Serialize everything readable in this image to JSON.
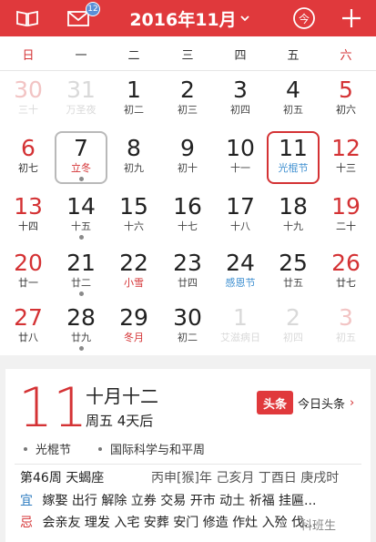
{
  "header": {
    "title": "2016年11月",
    "mail_badge": "12",
    "today_label": "今",
    "add_label": "+"
  },
  "weekdays": [
    "日",
    "一",
    "二",
    "三",
    "四",
    "五",
    "六"
  ],
  "calendar": {
    "rows": [
      [
        {
          "day": "30",
          "sub": "三十",
          "other": true
        },
        {
          "day": "31",
          "sub": "万圣夜",
          "other": true,
          "festival": "blue"
        },
        {
          "day": "1",
          "sub": "初二"
        },
        {
          "day": "2",
          "sub": "初三"
        },
        {
          "day": "3",
          "sub": "初四"
        },
        {
          "day": "4",
          "sub": "初五"
        },
        {
          "day": "5",
          "sub": "初六"
        }
      ],
      [
        {
          "day": "6",
          "sub": "初七"
        },
        {
          "day": "7",
          "sub": "立冬",
          "festival": "red",
          "today": true,
          "dot": true
        },
        {
          "day": "8",
          "sub": "初九"
        },
        {
          "day": "9",
          "sub": "初十"
        },
        {
          "day": "10",
          "sub": "十一"
        },
        {
          "day": "11",
          "sub": "光棍节",
          "festival": "blue",
          "selected": true
        },
        {
          "day": "12",
          "sub": "十三"
        }
      ],
      [
        {
          "day": "13",
          "sub": "十四"
        },
        {
          "day": "14",
          "sub": "十五",
          "dot": true
        },
        {
          "day": "15",
          "sub": "十六"
        },
        {
          "day": "16",
          "sub": "十七"
        },
        {
          "day": "17",
          "sub": "十八"
        },
        {
          "day": "18",
          "sub": "十九"
        },
        {
          "day": "19",
          "sub": "二十"
        }
      ],
      [
        {
          "day": "20",
          "sub": "廿一"
        },
        {
          "day": "21",
          "sub": "廿二",
          "dot": true
        },
        {
          "day": "22",
          "sub": "小雪",
          "festival": "red"
        },
        {
          "day": "23",
          "sub": "廿四"
        },
        {
          "day": "24",
          "sub": "感恩节",
          "festival": "blue"
        },
        {
          "day": "25",
          "sub": "廿五"
        },
        {
          "day": "26",
          "sub": "廿七"
        }
      ],
      [
        {
          "day": "27",
          "sub": "廿八"
        },
        {
          "day": "28",
          "sub": "廿九",
          "dot": true
        },
        {
          "day": "29",
          "sub": "冬月",
          "festival": "red"
        },
        {
          "day": "30",
          "sub": "初二"
        },
        {
          "day": "1",
          "sub": "艾滋病日",
          "other": true,
          "festival": "blue"
        },
        {
          "day": "2",
          "sub": "初四",
          "other": true
        },
        {
          "day": "3",
          "sub": "初五",
          "other": true
        }
      ]
    ]
  },
  "detail": {
    "day": "11",
    "lunar_date": "十月十二",
    "week_info": "周五 4天后",
    "toutiao_logo": "头条",
    "toutiao_text": "今日头条",
    "toutiao_arrow": "›",
    "festivals": [
      "光棍节",
      "国际科学与和平周"
    ],
    "week_number": "第46周 天蝎座",
    "ganzhi": "丙申[猴]年 己亥月 丁酉日 庚戌时",
    "yi_label": "宜",
    "yi_items": "嫁娶 出行 解除 立券 交易 开市 动土 祈福 挂匾...",
    "ji_label": "忌",
    "ji_items": "会亲友 理发 入宅 安葬 安门 修造 作灶 入殓 伐..."
  },
  "watermark": "科班生",
  "colors": {
    "accent": "#e0393c",
    "festival_red": "#d43234",
    "festival_blue": "#3e8fd0"
  },
  "icons": [
    "book-icon",
    "mail-icon",
    "today-icon",
    "plus-icon",
    "chevron-down-icon"
  ]
}
